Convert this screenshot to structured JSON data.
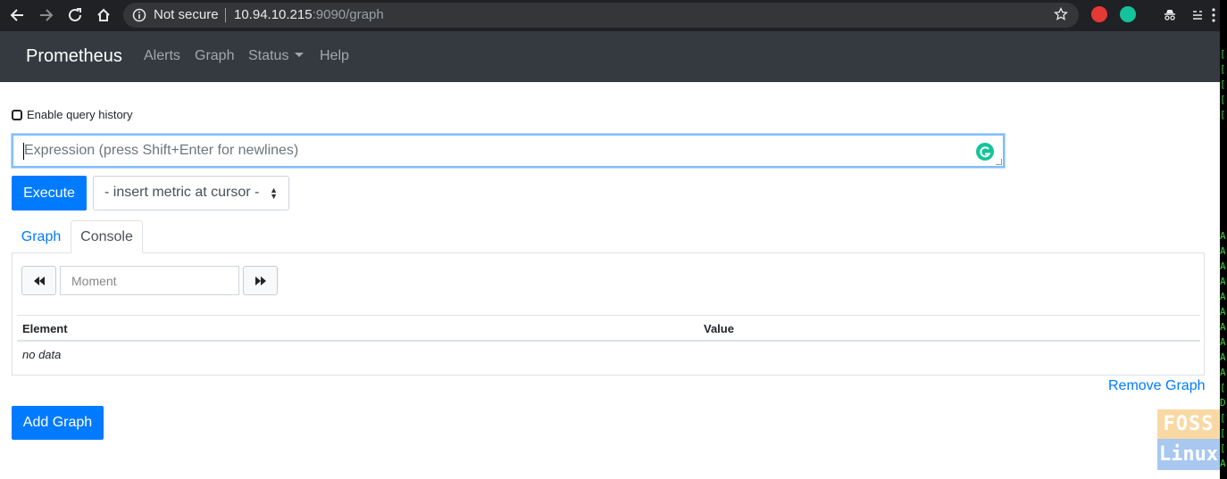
{
  "browser": {
    "security_label": "Not secure",
    "url_host": "10.94.10.215",
    "url_path": ":9090/graph"
  },
  "navbar": {
    "brand": "Prometheus",
    "links": [
      "Alerts",
      "Graph",
      "Status",
      "Help"
    ]
  },
  "query_history_label": "Enable query history",
  "expression": {
    "value": "",
    "placeholder": "Expression (press Shift+Enter for newlines)"
  },
  "execute_label": "Execute",
  "metric_select": "- insert metric at cursor -",
  "tabs": [
    "Graph",
    "Console"
  ],
  "active_tab": "Console",
  "console": {
    "moment_placeholder": "Moment",
    "columns": [
      "Element",
      "Value"
    ],
    "empty_text": "no data"
  },
  "remove_graph_label": "Remove Graph",
  "add_graph_label": "Add Graph",
  "watermark": {
    "top": "FOSS",
    "bottom": "Linux"
  },
  "colors": {
    "primary": "#007bff",
    "navbar_bg": "#343a40",
    "browser_bg": "#202124"
  }
}
